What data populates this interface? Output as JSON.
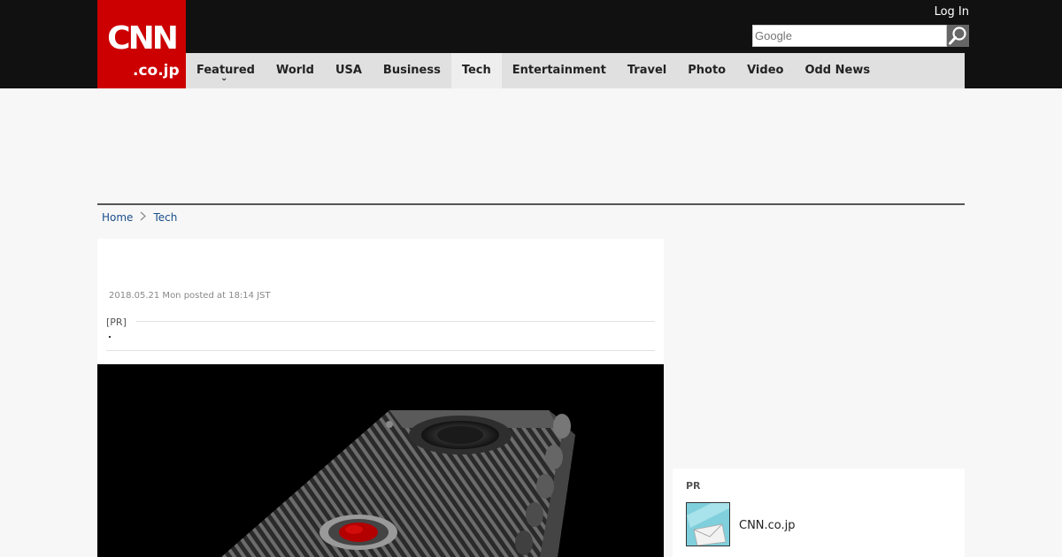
{
  "header": {
    "logo_main": "CNN",
    "logo_sub": ".co.jp",
    "login_label": "Log In",
    "search": {
      "placeholder": "Google",
      "value": ""
    }
  },
  "nav": {
    "items": [
      {
        "label": "Featured"
      },
      {
        "label": "World"
      },
      {
        "label": "USA"
      },
      {
        "label": "Business"
      },
      {
        "label": "Tech",
        "active": true
      },
      {
        "label": "Entertainment"
      },
      {
        "label": "Travel"
      },
      {
        "label": "Photo"
      },
      {
        "label": "Video"
      },
      {
        "label": "Odd News"
      }
    ],
    "featured_dropdown_icon": "chevron-down-icon"
  },
  "breadcrumb": {
    "items": [
      "Home",
      "Tech"
    ],
    "separator_icon": "chevron-right-icon"
  },
  "article": {
    "date": "2018.05.21 Mon posted at 18:14 JST",
    "pr_label": "[PR]"
  },
  "sidebar": {
    "pr": {
      "title": "PR",
      "item_label": "CNN.co.jp"
    }
  },
  "colors": {
    "brand_red": "#cc0000",
    "top_bar": "#111111",
    "nav_bg": "#e0e0e0",
    "link": "#1a4e8a",
    "page_bg": "#f7f7f7"
  }
}
